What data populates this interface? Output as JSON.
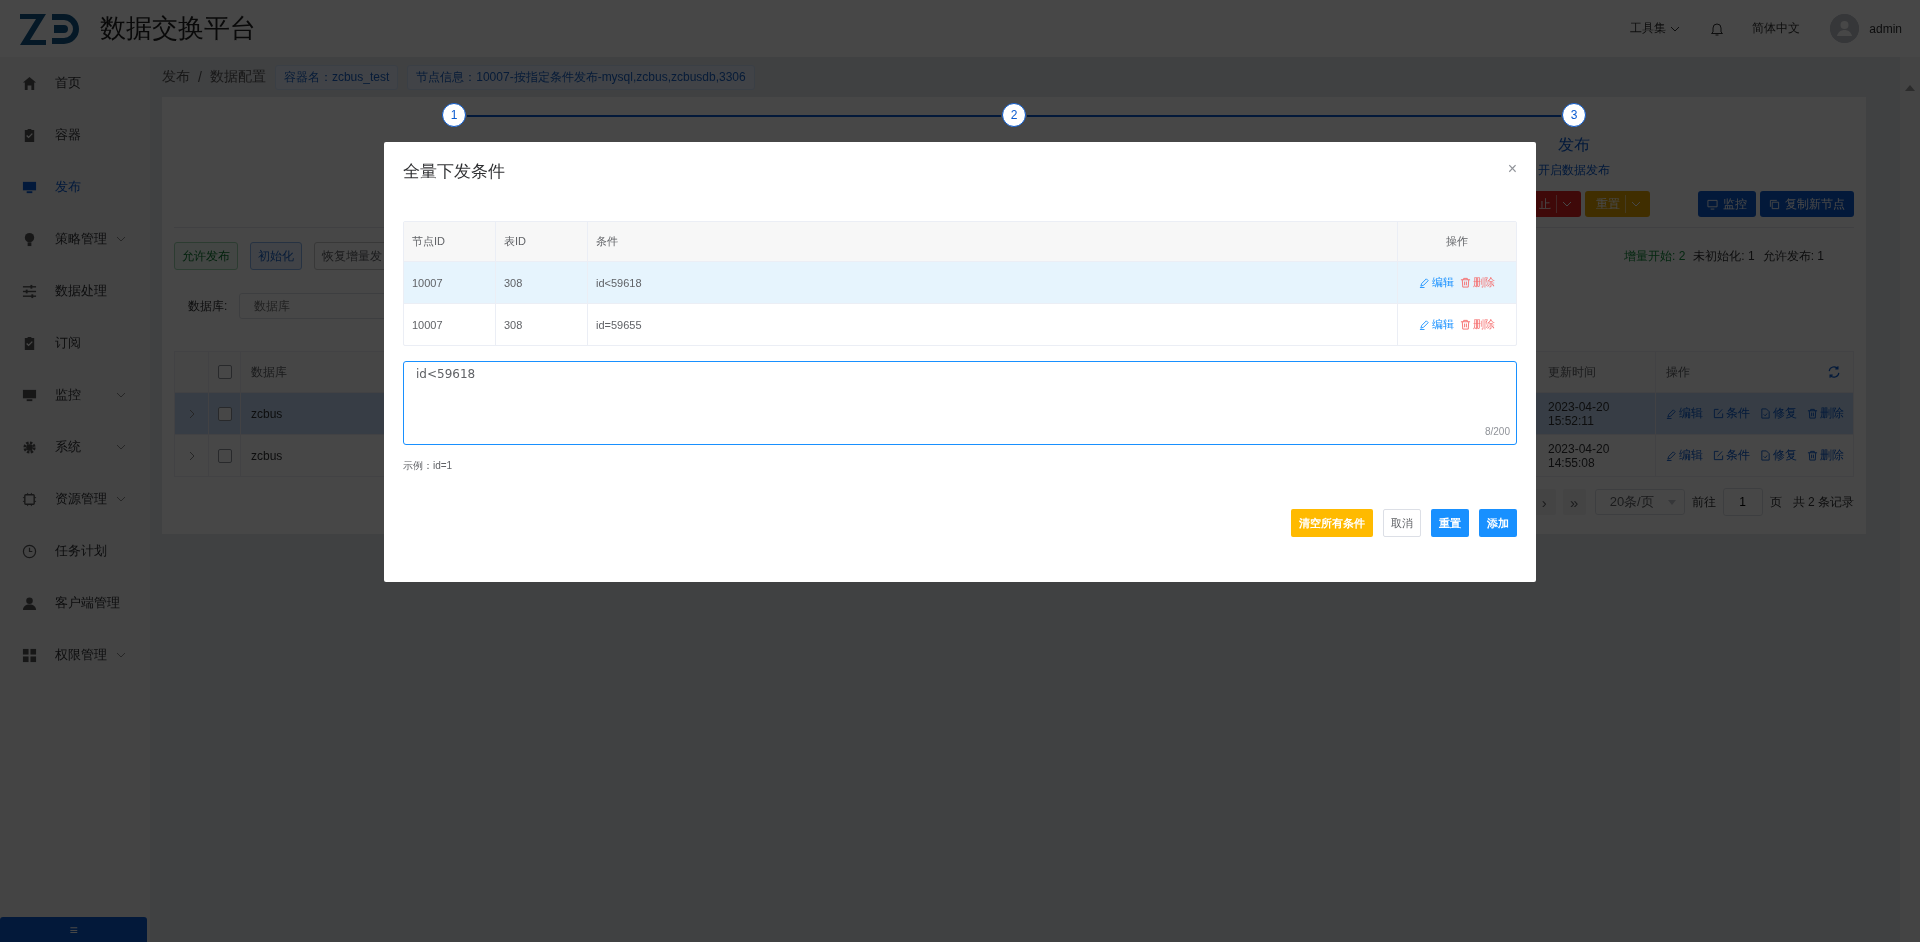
{
  "header": {
    "title": "数据交换平台",
    "tools": "工具集",
    "language": "简体中文",
    "user": "admin"
  },
  "sidebar": {
    "items": [
      {
        "label": "首页",
        "selected": false,
        "has_submenu": false
      },
      {
        "label": "容器",
        "selected": false,
        "has_submenu": false
      },
      {
        "label": "发布",
        "selected": true,
        "has_submenu": false
      },
      {
        "label": "策略管理",
        "selected": false,
        "has_submenu": true
      },
      {
        "label": "数据处理",
        "selected": false,
        "has_submenu": false
      },
      {
        "label": "订阅",
        "selected": false,
        "has_submenu": false
      },
      {
        "label": "监控",
        "selected": false,
        "has_submenu": true
      },
      {
        "label": "系统",
        "selected": false,
        "has_submenu": true
      },
      {
        "label": "资源管理",
        "selected": false,
        "has_submenu": true
      },
      {
        "label": "任务计划",
        "selected": false,
        "has_submenu": false
      },
      {
        "label": "客户端管理",
        "selected": false,
        "has_submenu": false
      },
      {
        "label": "权限管理",
        "selected": false,
        "has_submenu": true
      }
    ],
    "collapse": "≡"
  },
  "breadcrumb": {
    "items": [
      "发布",
      "数据配置"
    ],
    "separator": "/",
    "tags": [
      "容器名：zcbus_test",
      "节点信息：10007-按指定条件发布-mysql,zcbus,zcbusdb,3306"
    ]
  },
  "steps": [
    {
      "number": "1"
    },
    {
      "number": "2"
    },
    {
      "number": "3",
      "title": "发布",
      "description": "开启数据发布"
    }
  ],
  "toolbar": {
    "right_buttons": [
      {
        "label": "止",
        "kind": "danger-split"
      },
      {
        "label": "重置",
        "kind": "warning-split"
      },
      {
        "label": "监控",
        "kind": "monitor"
      },
      {
        "label": "复制新节点",
        "kind": "copy"
      }
    ],
    "left_buttons": [
      {
        "label": "允许发布",
        "kind": "success"
      },
      {
        "label": "初始化",
        "kind": "primary"
      },
      {
        "label": "恢复增量发",
        "kind": "plain"
      }
    ],
    "status": [
      {
        "text": "增量开始:  2",
        "kind": "success"
      },
      {
        "text": "未初始化: 1",
        "kind": "default"
      },
      {
        "text": "允许发布: 1",
        "kind": "default"
      }
    ]
  },
  "filter": {
    "label": "数据库:",
    "placeholder": "数据库"
  },
  "table": {
    "columns": [
      "数据库",
      "更新时间",
      "操作"
    ],
    "all_checked": false,
    "rows": [
      {
        "database": "zcbus",
        "updated": "2023-04-20 15:52:11",
        "selected": true,
        "checked": false,
        "actions": [
          "编辑",
          "条件",
          "修复",
          "删除"
        ]
      },
      {
        "database": "zcbus",
        "updated": "2023-04-20 14:55:08",
        "selected": false,
        "checked": false,
        "actions": [
          "编辑",
          "条件",
          "修复",
          "删除"
        ]
      }
    ]
  },
  "pagination": {
    "next": "›",
    "last": "»",
    "page_size": "20条/页",
    "goto": "前往",
    "page": "1",
    "page_unit": "页",
    "total": "共 2 条记录"
  },
  "dialog": {
    "title": "全量下发条件",
    "close": "×",
    "columns": [
      "节点ID",
      "表ID",
      "条件",
      "操作"
    ],
    "rows": [
      {
        "node_id": "10007",
        "table_id": "308",
        "condition": "id<59618",
        "selected": true,
        "actions": [
          "编辑",
          "删除"
        ]
      },
      {
        "node_id": "10007",
        "table_id": "308",
        "condition": "id=59655",
        "selected": false,
        "actions": [
          "编辑",
          "删除"
        ]
      }
    ],
    "input": {
      "value": "id<59618",
      "counter": "8/200"
    },
    "hint": "示例：id=1",
    "buttons": [
      {
        "label": "清空所有条件",
        "kind": "warning"
      },
      {
        "label": "取消",
        "kind": "default"
      },
      {
        "label": "重置",
        "kind": "primary"
      },
      {
        "label": "添加",
        "kind": "primary"
      }
    ]
  }
}
